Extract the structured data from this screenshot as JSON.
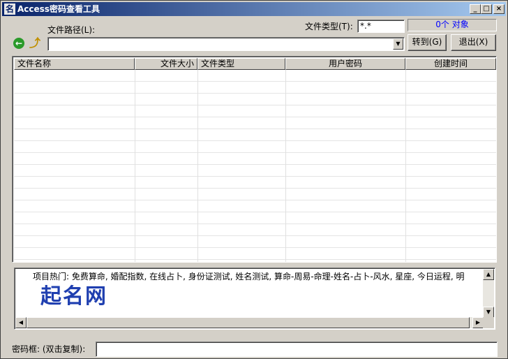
{
  "window": {
    "title": "Access密码查看工具",
    "app_icon_glyph": "名",
    "controls": {
      "minimize": "_",
      "maximize": "□",
      "close": "×"
    }
  },
  "toolbar": {
    "path_label": "文件路径(L):",
    "type_label": "文件类型(T):",
    "type_value": "*.*",
    "object_count": "0个 对象",
    "path_value": "",
    "goto_label": "转到(G)",
    "exit_label": "退出(X)",
    "back_icon": "back-arrow-icon",
    "up_icon": "up-folder-icon"
  },
  "table": {
    "columns": [
      "文件名称",
      "文件大小",
      "文件类型",
      "用户密码",
      "创建时间"
    ],
    "rows": []
  },
  "ad": {
    "text": "项目热门: 免费算命, 婚配指数, 在线占卜, 身份证测试, 姓名测试, 算命-周易-命理-姓名-占卜-风水, 星座, 今日运程, 明",
    "logo": "起名网"
  },
  "password": {
    "label": "密码框: (双击复制):",
    "value": ""
  }
}
